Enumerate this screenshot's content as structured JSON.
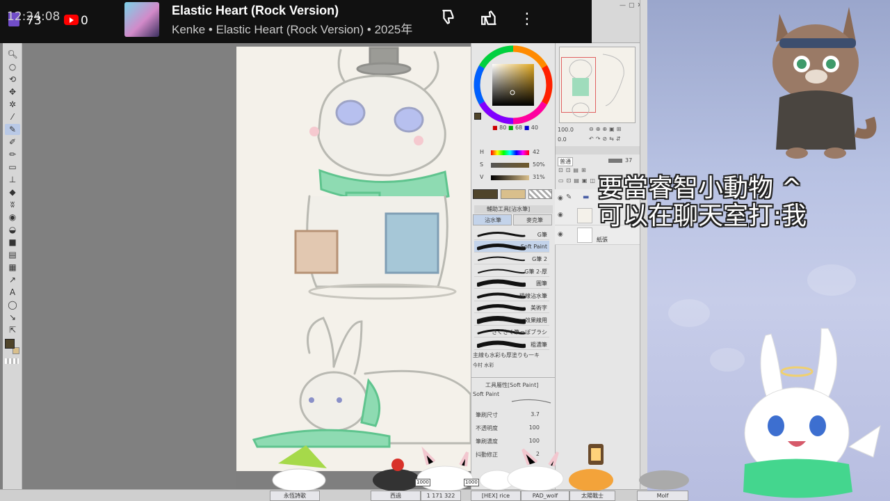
{
  "now_playing": {
    "clock": "12:24:08",
    "twitch_viewers": "73",
    "youtube_viewers": "0",
    "song_title": "Elastic Heart (Rock Version)",
    "song_subtitle": "Kenke • Elastic Heart (Rock Version) • 2025年"
  },
  "color_panel": {
    "rgb": [
      "80",
      "68",
      "40"
    ],
    "hsv_rows": [
      {
        "label": "H",
        "value": "42"
      },
      {
        "label": "S",
        "value": "50%"
      },
      {
        "label": "V",
        "value": "31%"
      }
    ],
    "main_color": "#4f442a",
    "sub_color": "#d9bf8c"
  },
  "brush_panel": {
    "header": "輔助工具[沾水筆]",
    "tabs": [
      "沾水筆",
      "麥克筆"
    ],
    "brushes": [
      {
        "label": "G筆",
        "selected": false
      },
      {
        "label": "Soft Paint",
        "selected": true
      },
      {
        "label": "G筆 2",
        "selected": false
      },
      {
        "label": "G筆 2-厚",
        "selected": false
      },
      {
        "label": "圓筆",
        "selected": false
      },
      {
        "label": "粗線沾水筆",
        "selected": false
      },
      {
        "label": "美術字",
        "selected": false
      },
      {
        "label": "效果線用",
        "selected": false
      },
      {
        "label": "さくさく筆っぽブラシ",
        "selected": false
      },
      {
        "label": "粗濃筆",
        "selected": false
      }
    ],
    "footer_brush": "主線も水彩も厚塗りも一キ",
    "footer_more": "今村 水彩"
  },
  "tool_property": {
    "header": "工具屬性[Soft Paint]",
    "brush_name": "Soft Paint",
    "rows": [
      {
        "label": "筆刷尺寸",
        "value": "3.7"
      },
      {
        "label": "不透明度",
        "value": "100"
      },
      {
        "label": "筆刷濃度",
        "value": "100"
      },
      {
        "label": "抖動修正",
        "value": "2"
      }
    ]
  },
  "navigator": {
    "zoom": "100.0",
    "angle": "0.0"
  },
  "layer_panel": {
    "blend_mode": "普通",
    "opacity": "37",
    "layers": [
      {
        "name": ""
      },
      {
        "name": ""
      },
      {
        "name": "紙張"
      }
    ]
  },
  "chat_overlay": {
    "line1": "要當睿智小動物 ^",
    "line2": "可以在聊天室打:我"
  },
  "viewers": [
    {
      "name": "永恆詩歌"
    },
    {
      "name": "西過"
    },
    {
      "name": "1 171 322"
    },
    {
      "name": "[HEX] rice"
    },
    {
      "name": "PAD_wolf"
    },
    {
      "name": "太陽戰士"
    },
    {
      "name": "Molf"
    }
  ],
  "counters": [
    "1000",
    "1000"
  ]
}
